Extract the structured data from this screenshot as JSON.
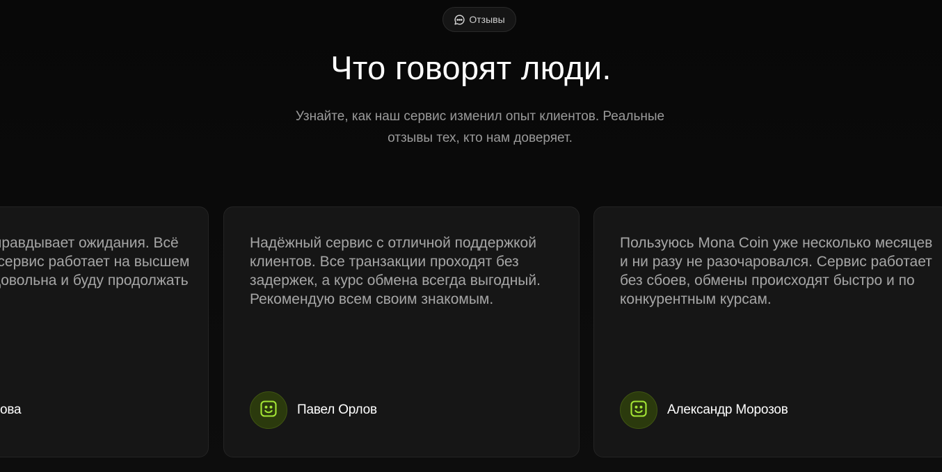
{
  "section": {
    "badge_label": "Отзывы",
    "badge_icon": "chat-bubble-icon",
    "title": "Что говорят люди.",
    "subtitle": "Узнайте, как наш сервис изменил опыт клиентов. Реальные отзывы тех, кто нам доверяет."
  },
  "testimonials": [
    {
      "text": "Действительно оправдывает ожидания. Всё просто и удобно, сервис работает на высшем уровне. Я очень довольна и буду продолжать пользоваться.",
      "author": "Анна Смирнова",
      "avatar_icon": "smiley-face-icon"
    },
    {
      "text": "Надёжный сервис с отличной поддержкой клиентов. Все транзакции проходят без задержек, а курс обмена всегда выгодный. Рекомендую всем своим знакомым.",
      "author": "Павел Орлов",
      "avatar_icon": "smiley-face-icon"
    },
    {
      "text": "Пользуюсь Mona Coin уже несколько месяцев и ни разу не разочаровался. Сервис работает без сбоев, обмены происходят быстро и по конкурентным курсам.",
      "author": "Александр Морозов",
      "avatar_icon": "smiley-face-icon"
    }
  ],
  "colors": {
    "background": "#0b0b0b",
    "card_background": "#161616",
    "accent_green": "#a3e635",
    "avatar_background": "#2b3a0d",
    "text_primary": "#ffffff",
    "text_secondary": "#a6a6a6"
  }
}
